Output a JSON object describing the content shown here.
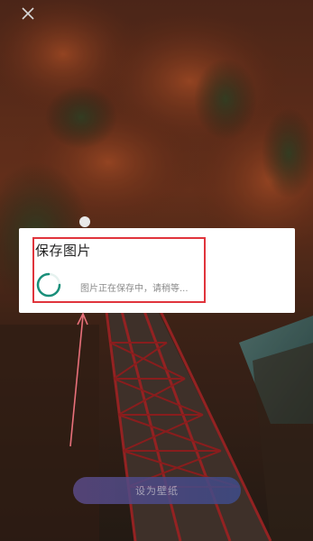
{
  "dialog": {
    "title": "保存图片",
    "status_text": "图片正在保存中，请稍等..."
  },
  "actions": {
    "set_wallpaper_label": "设为壁纸"
  },
  "icons": {
    "close": "close-icon",
    "spinner": "loading-spinner-icon"
  },
  "colors": {
    "spinner": "#1a8f7a",
    "highlight": "#e0343c",
    "button_start": "#5a4a86",
    "button_end": "#3e4c8a"
  }
}
